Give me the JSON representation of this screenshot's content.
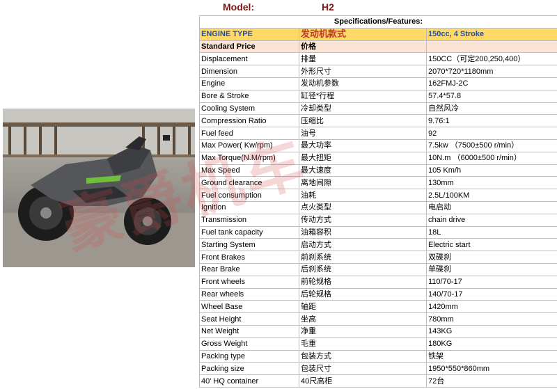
{
  "header": {
    "model_label": "Model:",
    "model_value": "H2"
  },
  "table": {
    "title": "Specifications/Features:",
    "rows": [
      {
        "en": "ENGINE TYPE",
        "cn": "发动机款式",
        "val": "150cc, 4 Stroke"
      },
      {
        "en": "Standard Price",
        "cn": "价格",
        "val": ""
      },
      {
        "en": "Displacement",
        "cn": "排量",
        "val": "150CC（可定200,250,400）"
      },
      {
        "en": "Dimension",
        "cn": "外形尺寸",
        "val": "2070*720*1180mm"
      },
      {
        "en": "Engine",
        "cn": "发动机参数",
        "val": "162FMJ-2C"
      },
      {
        "en": "Bore & Stroke",
        "cn": "缸径*行程",
        "val": "57.4*57.8"
      },
      {
        "en": "Cooling System",
        "cn": "冷却类型",
        "val": "自然风冷"
      },
      {
        "en": "Compression Ratio",
        "cn": "压缩比",
        "val": "9.76:1"
      },
      {
        "en": "Fuel feed",
        "cn": "油号",
        "val": "92"
      },
      {
        "en": "Max Power( Kw/rpm)",
        "cn": "最大功率",
        "val": "7.5kw （7500±500 r/min）"
      },
      {
        "en": "Max Torque(N.M/rpm)",
        "cn": "最大扭矩",
        "val": "10N.m （6000±500 r/min）"
      },
      {
        "en": "Max Speed",
        "cn": "最大速度",
        "val": "105 Km/h"
      },
      {
        "en": "Ground clearance",
        "cn": "离地间隙",
        "val": "130mm"
      },
      {
        "en": "Fuel consumption",
        "cn": "油耗",
        "val": "2.5L/100KM"
      },
      {
        "en": "Ignition",
        "cn": "点火类型",
        "val": "电启动"
      },
      {
        "en": "Transmission",
        "cn": "传动方式",
        "val": "chain drive"
      },
      {
        "en": "Fuel tank capacity",
        "cn": "油箱容积",
        "val": "18L"
      },
      {
        "en": "Starting System",
        "cn": "启动方式",
        "val": "Electric start"
      },
      {
        "en": "Front Brakes",
        "cn": "前刹系统",
        "val": "双碟刹"
      },
      {
        "en": "Rear Brake",
        "cn": "后刹系统",
        "val": "单碟刹"
      },
      {
        "en": "Front wheels",
        "cn": "前轮规格",
        "val": "110/70-17"
      },
      {
        "en": "Rear wheels",
        "cn": "后轮规格",
        "val": "140/70-17"
      },
      {
        "en": "Wheel Base",
        "cn": "轴距",
        "val": "1420mm"
      },
      {
        "en": "Seat Height",
        "cn": "坐高",
        "val": "780mm"
      },
      {
        "en": "Net Weight",
        "cn": "净重",
        "val": "143KG"
      },
      {
        "en": "Gross Weight",
        "cn": "毛重",
        "val": "180KG"
      },
      {
        "en": "Packing type",
        "cn": "包装方式",
        "val": "铁架"
      },
      {
        "en": "Packing size",
        "cn": "包装尺寸",
        "val": "1950*550*860mm"
      },
      {
        "en": "40' HQ container",
        "cn": "40尺高柜",
        "val": "72台"
      }
    ]
  },
  "watermark": "豪爵机车",
  "colors": {
    "title": "#7a1616",
    "engine_row_bg": "#ffd966",
    "engine_row_text": "#1f4fa8",
    "watermark": "#d64848"
  }
}
